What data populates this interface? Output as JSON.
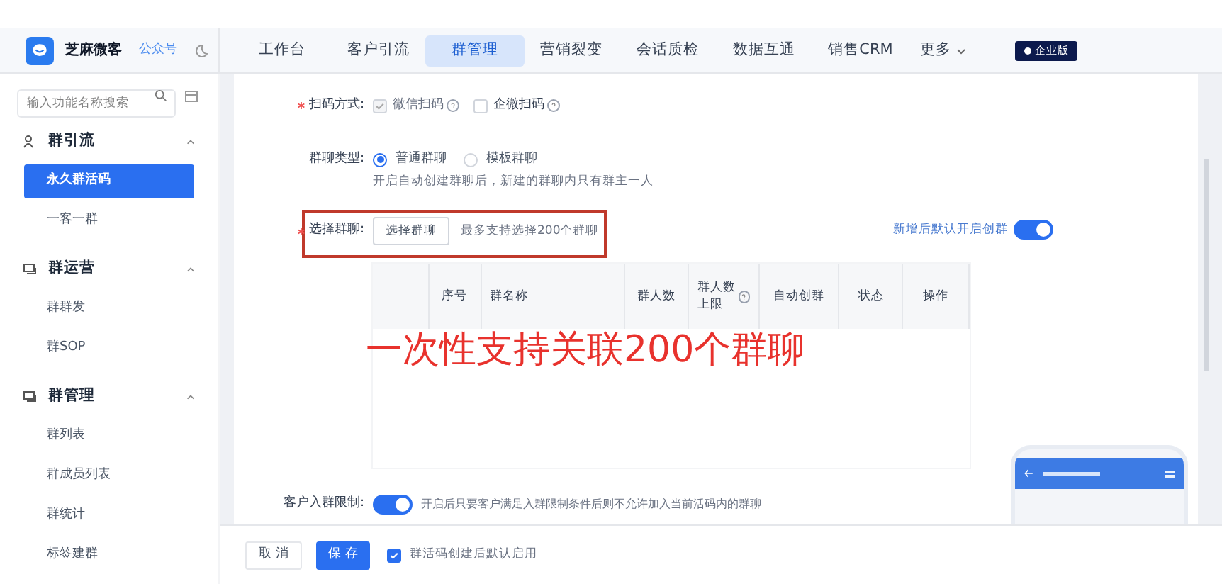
{
  "brand": {
    "name": "芝麻微客",
    "link": "公众号"
  },
  "nav": [
    {
      "label": "工作台",
      "selected": false
    },
    {
      "label": "客户引流",
      "selected": false
    },
    {
      "label": "群管理",
      "selected": true
    },
    {
      "label": "营销裂变",
      "selected": false
    },
    {
      "label": "会话质检",
      "selected": false
    },
    {
      "label": "数据互通",
      "selected": false
    },
    {
      "label": "销售CRM",
      "selected": false
    }
  ],
  "nav_more": "更多",
  "edition_badge": "企业版",
  "sidebar": {
    "search_placeholder": "输入功能名称搜索",
    "groups": [
      {
        "label": "群引流",
        "expanded": true,
        "items": [
          {
            "label": "永久群活码",
            "selected": true
          },
          {
            "label": "一客一群",
            "selected": false
          }
        ]
      },
      {
        "label": "群运营",
        "expanded": true,
        "items": [
          {
            "label": "群群发",
            "selected": false
          },
          {
            "label": "群SOP",
            "selected": false
          }
        ]
      },
      {
        "label": "群管理",
        "expanded": true,
        "items": [
          {
            "label": "群列表",
            "selected": false
          },
          {
            "label": "群成员列表",
            "selected": false
          },
          {
            "label": "群统计",
            "selected": false
          },
          {
            "label": "标签建群",
            "selected": false
          }
        ]
      }
    ]
  },
  "form": {
    "scan": {
      "label": "扫码方式:",
      "required": true,
      "options": [
        {
          "label": "微信扫码",
          "checked": true,
          "disabled": true
        },
        {
          "label": "企微扫码",
          "checked": false,
          "disabled": false
        }
      ]
    },
    "chat_type": {
      "label": "群聊类型:",
      "options": [
        {
          "label": "普通群聊",
          "selected": true
        },
        {
          "label": "模板群聊",
          "selected": false
        }
      ],
      "hint": "开启自动创建群聊后，新建的群聊内只有群主一人"
    },
    "select": {
      "label": "选择群聊:",
      "required": true,
      "button": "选择群聊",
      "hint": "最多支持选择200个群聊"
    },
    "auto_toggle": {
      "label": "新增后默认开启创群",
      "on": true
    },
    "table": {
      "columns": [
        "序号",
        "群名称",
        "群人数",
        "群人数上限",
        "自动创群",
        "状态",
        "操作"
      ]
    },
    "limit": {
      "label": "客户入群限制:",
      "on": true,
      "hint": "开启后只要客户满足入群限制条件后则不允许加入当前活码内的群聊"
    }
  },
  "annotation": "一次性支持关联200个群聊",
  "footer": {
    "cancel": "取 消",
    "save": "保 存",
    "default_enable": {
      "label": "群活码创建后默认启用",
      "checked": true
    }
  }
}
